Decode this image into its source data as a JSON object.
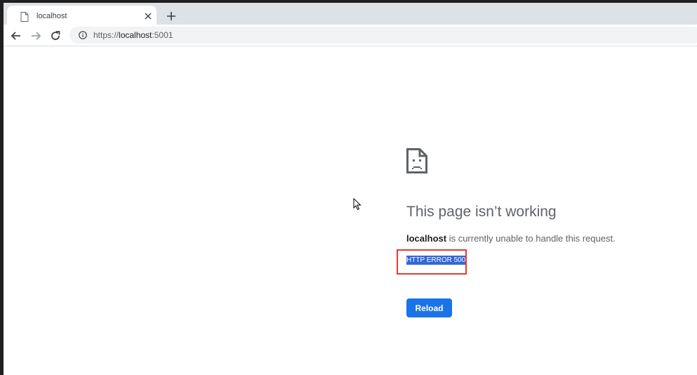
{
  "browser": {
    "tab": {
      "title": "localhost",
      "favicon": "page-icon"
    },
    "toolbar": {
      "back_icon": "back-arrow-icon",
      "forward_icon": "forward-arrow-icon",
      "reload_icon": "reload-icon",
      "site_info_icon": "info-icon",
      "url_scheme": "https://",
      "url_host": "localhost",
      "url_port": ":5001"
    }
  },
  "error_page": {
    "icon": "sad-page-icon",
    "heading": "This page isn’t working",
    "host": "localhost",
    "message_rest": " is currently unable to handle this request.",
    "error_code": "HTTP ERROR 500",
    "reload_label": "Reload"
  },
  "colors": {
    "accent": "#1a73e8",
    "selection": "#3367d6",
    "highlight_box": "#e53935"
  }
}
